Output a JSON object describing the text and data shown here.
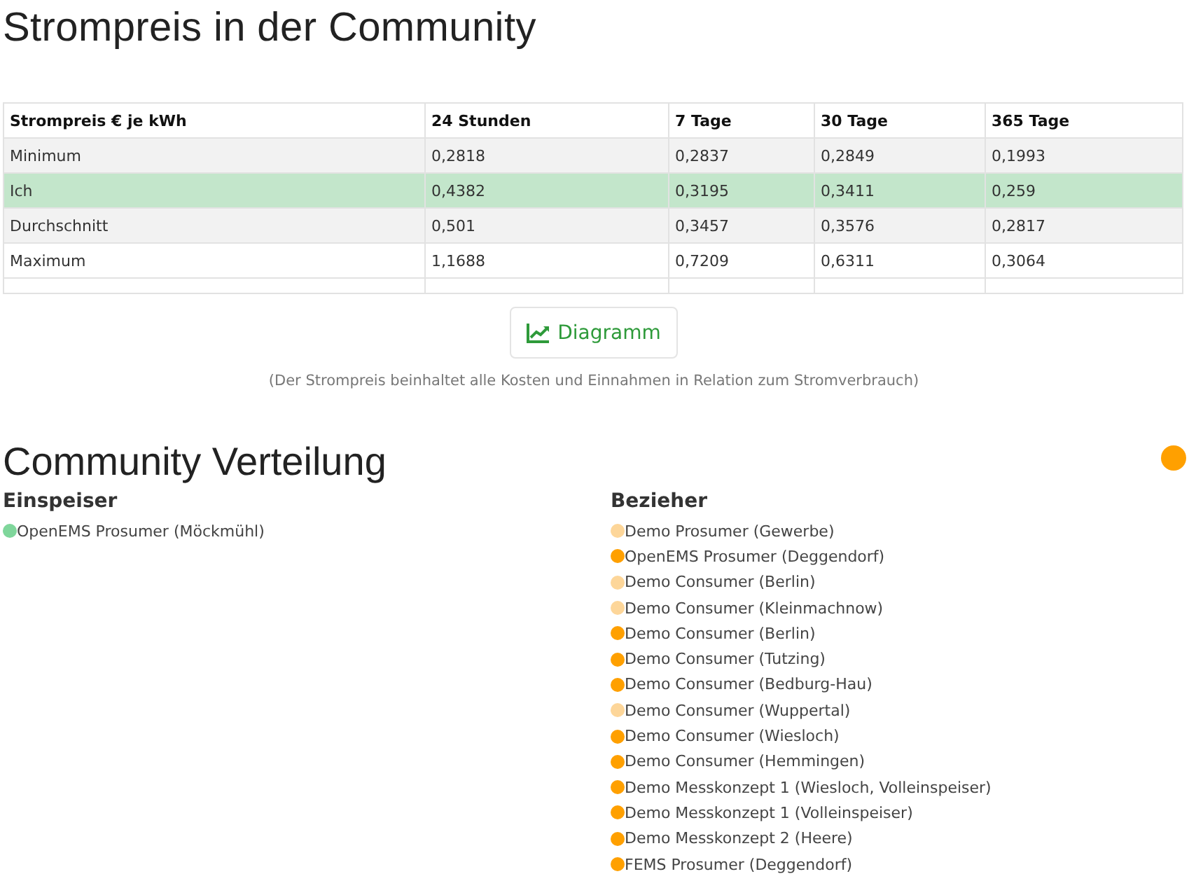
{
  "title": "Strompreis in der Community",
  "table": {
    "columns": [
      "Strompreis € je kWh",
      "24 Stunden",
      "7 Tage",
      "30 Tage",
      "365 Tage"
    ],
    "rows": [
      {
        "cells": [
          "Minimum",
          "0,2818",
          "0,2837",
          "0,2849",
          "0,1993"
        ],
        "highlighted": false
      },
      {
        "cells": [
          "Ich",
          "0,4382",
          "0,3195",
          "0,3411",
          "0,259"
        ],
        "highlighted": true
      },
      {
        "cells": [
          "Durchschnitt",
          "0,501",
          "0,3457",
          "0,3576",
          "0,2817"
        ],
        "highlighted": false
      },
      {
        "cells": [
          "Maximum",
          "1,1688",
          "0,7209",
          "0,6311",
          "0,3064"
        ],
        "highlighted": false
      }
    ]
  },
  "chart_button": {
    "label": "Diagramm"
  },
  "note": "(Der Strompreis beinhaltet alle Kosten und Einnahmen in Relation zum Stromverbrauch)",
  "distribution": {
    "title": "Community Verteilung",
    "groups": [
      {
        "title": "Einspeiser",
        "items": [
          {
            "name": "OpenEMS Prosumer (Möckmühl)",
            "color": "#7fd69b"
          }
        ]
      },
      {
        "title": "Bezieher",
        "items": [
          {
            "name": "Demo Prosumer (Gewerbe)",
            "color": "#fdd699"
          },
          {
            "name": "OpenEMS Prosumer (Deggendorf)",
            "color": "#ffa000"
          },
          {
            "name": "Demo Consumer (Berlin)",
            "color": "#fdd699"
          },
          {
            "name": "Demo Consumer (Kleinmachnow)",
            "color": "#fdd699"
          },
          {
            "name": "Demo Consumer (Berlin)",
            "color": "#ffa000"
          },
          {
            "name": "Demo Consumer (Tutzing)",
            "color": "#ffa000"
          },
          {
            "name": "Demo Consumer (Bedburg-Hau)",
            "color": "#ffa000"
          },
          {
            "name": "Demo Consumer (Wuppertal)",
            "color": "#fdd699"
          },
          {
            "name": "Demo Consumer (Wiesloch)",
            "color": "#ffa000"
          },
          {
            "name": "Demo Consumer (Hemmingen)",
            "color": "#ffa000"
          },
          {
            "name": "Demo Messkonzept 1 (Wiesloch, Volleinspeiser)",
            "color": "#ffa000"
          },
          {
            "name": "Demo Messkonzept 1 (Volleinspeiser)",
            "color": "#ffa000"
          },
          {
            "name": "Demo Messkonzept 2 (Heere)",
            "color": "#ffa000"
          },
          {
            "name": "FEMS Prosumer (Deggendorf)",
            "color": "#ffa000"
          }
        ]
      }
    ]
  }
}
